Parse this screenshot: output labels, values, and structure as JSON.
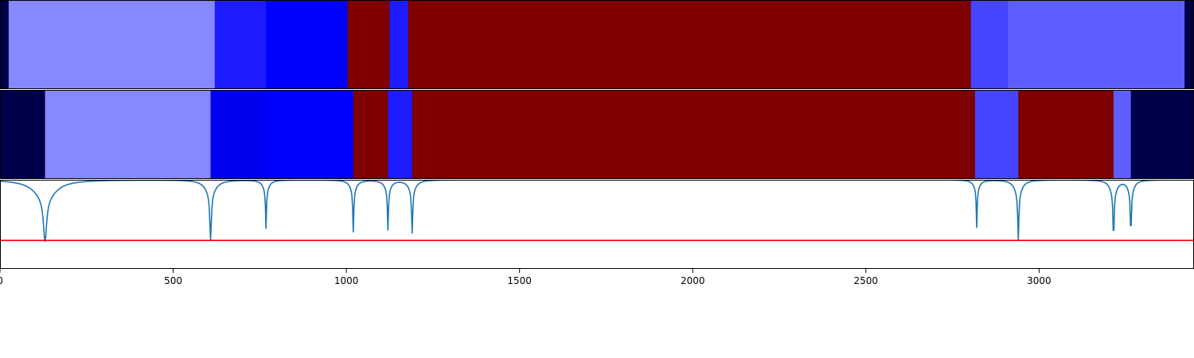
{
  "chart_data": [
    {
      "type": "heatmap",
      "segments": [
        {
          "x0": 0,
          "x1": 25,
          "color": "#00004a"
        },
        {
          "x0": 25,
          "x1": 620,
          "color": "#8787ff"
        },
        {
          "x0": 620,
          "x1": 768,
          "color": "#1c1cff"
        },
        {
          "x0": 768,
          "x1": 1003,
          "color": "#0000ff"
        },
        {
          "x0": 1003,
          "x1": 1125,
          "color": "#7f0000"
        },
        {
          "x0": 1125,
          "x1": 1178,
          "color": "#1c1cff"
        },
        {
          "x0": 1178,
          "x1": 2803,
          "color": "#7f0000"
        },
        {
          "x0": 2803,
          "x1": 2910,
          "color": "#4545ff"
        },
        {
          "x0": 2910,
          "x1": 3420,
          "color": "#5e5eff"
        },
        {
          "x0": 3420,
          "x1": 3445,
          "color": "#00004a"
        }
      ],
      "xlim": [
        0,
        3445
      ]
    },
    {
      "type": "heatmap",
      "segments": [
        {
          "x0": 0,
          "x1": 130,
          "color": "#00004a"
        },
        {
          "x0": 130,
          "x1": 608,
          "color": "#8787ff"
        },
        {
          "x0": 608,
          "x1": 765,
          "color": "#0000f0"
        },
        {
          "x0": 765,
          "x1": 1020,
          "color": "#0000ff"
        },
        {
          "x0": 1020,
          "x1": 1120,
          "color": "#7f0000"
        },
        {
          "x0": 1120,
          "x1": 1190,
          "color": "#1c1cff"
        },
        {
          "x0": 1190,
          "x1": 2815,
          "color": "#7f0000"
        },
        {
          "x0": 2815,
          "x1": 2940,
          "color": "#4545ff"
        },
        {
          "x0": 2940,
          "x1": 3215,
          "color": "#7f0000"
        },
        {
          "x0": 3215,
          "x1": 3265,
          "color": "#5e5eff"
        },
        {
          "x0": 3265,
          "x1": 3445,
          "color": "#00004a"
        }
      ],
      "xlim": [
        0,
        3445
      ]
    },
    {
      "type": "line",
      "xlim": [
        0,
        3445
      ],
      "ylim": [
        0,
        1
      ],
      "x_ticks": [
        0,
        500,
        1000,
        1500,
        2000,
        2500,
        3000
      ],
      "grid": false,
      "series": [
        {
          "color": "#1f77b4",
          "baseline": 1.0,
          "dips": [
            {
              "x": 130,
              "depth": 0.48,
              "width": 45,
              "shoulder": 0.45
            },
            {
              "x": 608,
              "depth": 0.52,
              "width": 22,
              "shoulder": 0.3
            },
            {
              "x": 768,
              "depth": 0.42,
              "width": 12,
              "shoulder": 0.3
            },
            {
              "x": 1020,
              "depth": 0.47,
              "width": 14,
              "shoulder": 0.25
            },
            {
              "x": 1120,
              "depth": 0.45,
              "width": 14,
              "shoulder": 0.25
            },
            {
              "x": 1190,
              "depth": 0.48,
              "width": 16,
              "shoulder": 0.25
            },
            {
              "x": 2820,
              "depth": 0.43,
              "width": 12,
              "shoulder": 0.25
            },
            {
              "x": 2940,
              "depth": 0.52,
              "width": 16,
              "shoulder": 0.3
            },
            {
              "x": 3215,
              "depth": 0.54,
              "width": 14,
              "shoulder": 0.3
            },
            {
              "x": 3265,
              "depth": 0.52,
              "width": 12,
              "shoulder": 0.3
            }
          ]
        }
      ],
      "threshold": {
        "y": 0.32,
        "color": "#ff0000"
      }
    }
  ]
}
